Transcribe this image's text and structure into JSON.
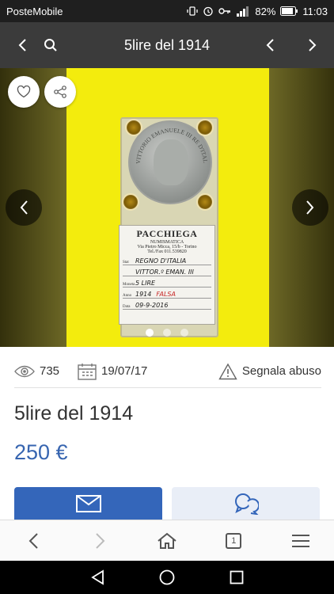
{
  "status_bar": {
    "carrier": "PosteMobile",
    "battery": "82%",
    "time": "11:03"
  },
  "app_bar": {
    "title": "5lire del 1914",
    "icons": [
      "chevron-left-icon",
      "search-icon",
      "chevron-left-icon",
      "chevron-right-icon"
    ]
  },
  "gallery": {
    "image_count": 3,
    "active_index": 0,
    "label": {
      "brand": "PACCHIEGA",
      "sub": "NUMISMATICA",
      "address": "Via Pietro Micca, 15/b - Torino",
      "phone": "Tel./Fax 011.539820",
      "rows": [
        {
          "key": "Stat",
          "value": "REGNO D'ITALIA",
          "extra": ""
        },
        {
          "key": "",
          "value": "VITTOR.º EMAN. III",
          "extra": ""
        },
        {
          "key": "Moneta",
          "value": "5 LIRE",
          "extra": ""
        },
        {
          "key": "Anno",
          "value": "1914",
          "extra": "FALSA"
        },
        {
          "key": "Data",
          "value": "09-9-2016",
          "extra": ""
        }
      ]
    },
    "coin_legend": "VITTORIO EMANUELE III RE D'ITALIA"
  },
  "meta": {
    "views": "735",
    "date": "19/07/17",
    "report_label": "Segnala abuso"
  },
  "listing": {
    "title": "5lire del 1914",
    "price": "250 €"
  },
  "browser": {
    "tab_count": "1"
  },
  "colors": {
    "accent": "#3466ba",
    "price": "#3765b0",
    "appbar": "#3b3b3b"
  }
}
